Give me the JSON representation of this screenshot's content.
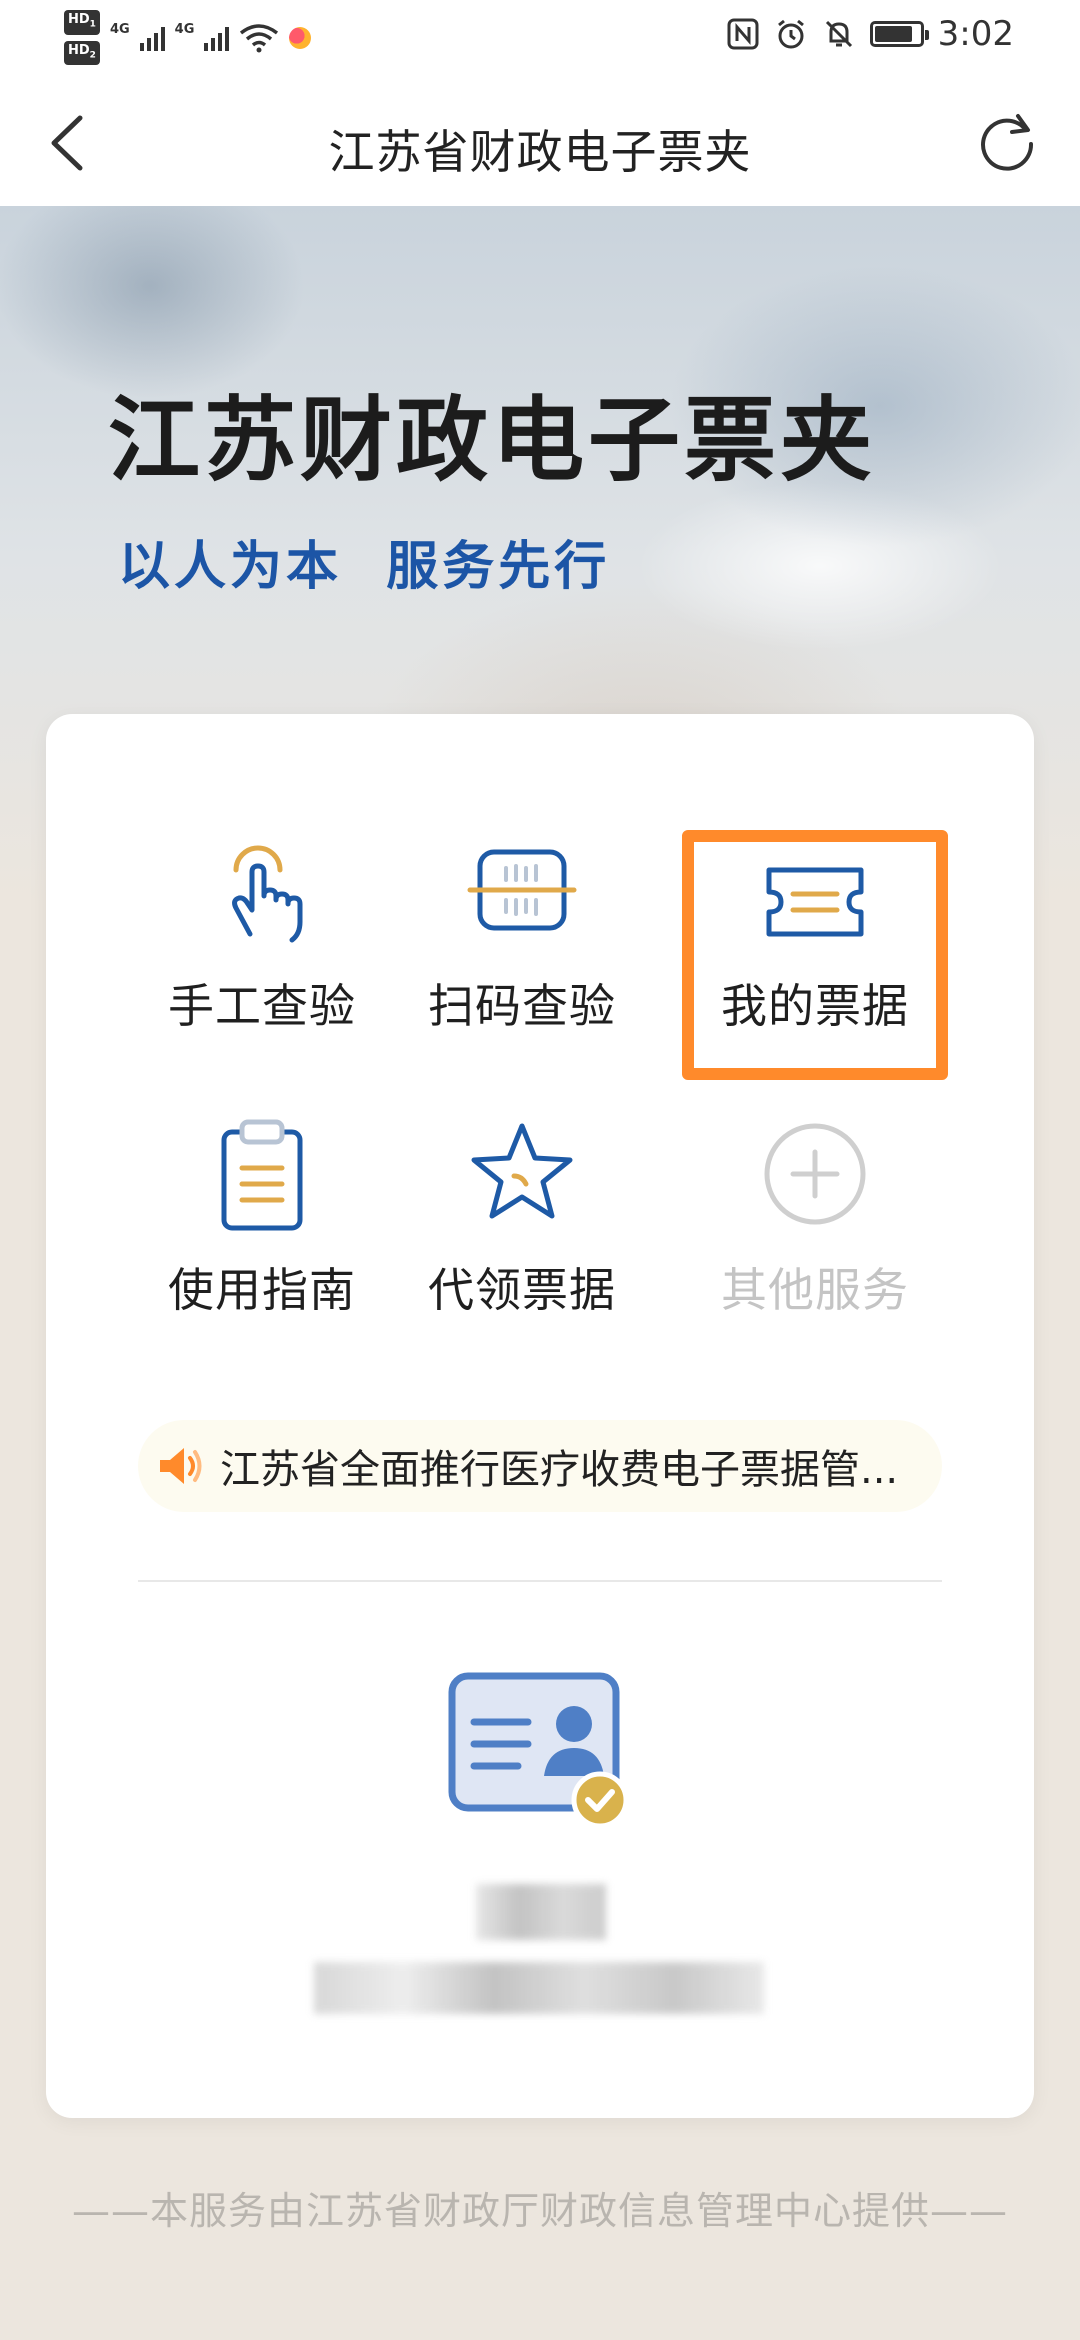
{
  "status_bar": {
    "hd1": "HD",
    "hd2": "HD",
    "net1": "4G",
    "net2": "4G",
    "time": "3:02",
    "battery_level": 0.85,
    "icons": [
      "hd-icon",
      "signal-icon",
      "wifi-icon",
      "health-app-icon",
      "nfc-icon",
      "alarm-icon",
      "mute-icon",
      "battery-icon"
    ]
  },
  "navbar": {
    "title": "江苏省财政电子票夹",
    "back_icon": "chevron-left-icon",
    "refresh_icon": "refresh-icon"
  },
  "banner": {
    "title": "江苏财政电子票夹",
    "slogan": "以人为本  服务先行"
  },
  "services": [
    {
      "label": "手工查验",
      "icon": "hand-tap-icon"
    },
    {
      "label": "扫码查验",
      "icon": "scan-icon"
    },
    {
      "label": "我的票据",
      "icon": "ticket-icon",
      "highlighted": true
    },
    {
      "label": "使用指南",
      "icon": "clipboard-icon"
    },
    {
      "label": "代领票据",
      "icon": "star-icon"
    },
    {
      "label": "其他服务",
      "icon": "plus-circle-icon",
      "disabled": true
    }
  ],
  "notice": {
    "text": "江苏省全面推行医疗收费电子票据管...",
    "icon": "speaker-icon"
  },
  "profile": {
    "icon": "id-card-verified-icon"
  },
  "footer": {
    "text": "——本服务由江苏省财政厅财政信息管理中心提供——"
  },
  "colors": {
    "accent_blue": "#1c55a6",
    "icon_gold": "#e0a94a",
    "highlight_orange": "#ff8a2b",
    "background": "#ece6de"
  }
}
